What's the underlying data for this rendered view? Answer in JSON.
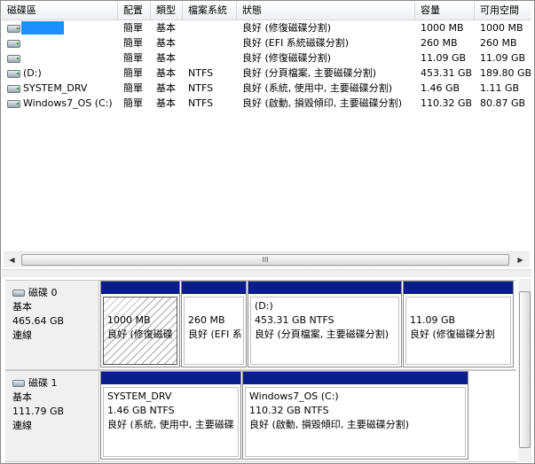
{
  "columns": [
    "磁碟區",
    "配置",
    "類型",
    "檔案系統",
    "狀態",
    "容量",
    "可用空間"
  ],
  "volumes": [
    {
      "name": "",
      "layout": "簡單",
      "type": "基本",
      "fs": "",
      "status": "良好 (修復磁碟分割)",
      "capacity": "1000 MB",
      "free": "1000 MB"
    },
    {
      "name": "",
      "layout": "簡單",
      "type": "基本",
      "fs": "",
      "status": "良好 (EFI 系統磁碟分割)",
      "capacity": "260 MB",
      "free": "260 MB"
    },
    {
      "name": "",
      "layout": "簡單",
      "type": "基本",
      "fs": "",
      "status": "良好 (修復磁碟分割)",
      "capacity": "11.09 GB",
      "free": "11.09 GB"
    },
    {
      "name": "(D:)",
      "layout": "簡單",
      "type": "基本",
      "fs": "NTFS",
      "status": "良好 (分頁檔案, 主要磁碟分割)",
      "capacity": "453.31 GB",
      "free": "189.80 GB"
    },
    {
      "name": "SYSTEM_DRV",
      "layout": "簡單",
      "type": "基本",
      "fs": "NTFS",
      "status": "良好 (系統, 使用中, 主要磁碟分割)",
      "capacity": "1.46 GB",
      "free": "1.11 GB"
    },
    {
      "name": "Windows7_OS (C:)",
      "layout": "簡單",
      "type": "基本",
      "fs": "NTFS",
      "status": "良好 (啟動, 損毀傾印, 主要磁碟分割)",
      "capacity": "110.32 GB",
      "free": "80.87 GB"
    }
  ],
  "scrollbar": {
    "grip": "III",
    "left_arrow": "◀",
    "right_arrow": "▶"
  },
  "disks": [
    {
      "title": "磁碟 0",
      "kind": "基本",
      "size": "465.64 GB",
      "state": "連線",
      "partitions": [
        {
          "name": "",
          "size": "1000 MB",
          "status": "良好 (修復磁碟",
          "hatched": true
        },
        {
          "name": "",
          "size": "260 MB",
          "status": "良好 (EFI 系",
          "hatched": false
        },
        {
          "name": "(D:)",
          "size": "453.31 GB NTFS",
          "status": "良好 (分頁檔案, 主要磁碟分割)",
          "hatched": false
        },
        {
          "name": "",
          "size": "11.09 GB",
          "status": "良好 (修復磁碟分割",
          "hatched": false
        }
      ]
    },
    {
      "title": "磁碟 1",
      "kind": "基本",
      "size": "111.79 GB",
      "state": "連線",
      "partitions": [
        {
          "name": "SYSTEM_DRV",
          "size": "1.46 GB NTFS",
          "status": "良好 (系統, 使用中, 主要磁碟",
          "hatched": false
        },
        {
          "name": "Windows7_OS (C:)",
          "size": "110.32 GB NTFS",
          "status": "良好 (啟動, 損毀傾印, 主要磁碟分割)",
          "hatched": false
        }
      ]
    }
  ],
  "colors": {
    "partition_header": "#0a1e8a",
    "redaction": "#1e8fff"
  }
}
